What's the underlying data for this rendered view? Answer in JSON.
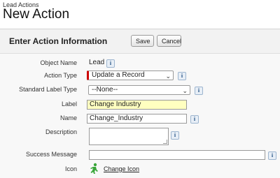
{
  "header": {
    "breadcrumb": "Lead Actions",
    "title": "New Action"
  },
  "panel": {
    "title": "Enter Action Information",
    "save_label": "Save",
    "cancel_label": "Cancel"
  },
  "fields": {
    "object_name": {
      "label": "Object Name",
      "value": "Lead"
    },
    "action_type": {
      "label": "Action Type",
      "value": "Update a Record"
    },
    "standard_label_type": {
      "label": "Standard Label Type",
      "value": "--None--"
    },
    "label": {
      "label": "Label",
      "value": "Change Industry"
    },
    "name": {
      "label": "Name",
      "value": "Change_Industry"
    },
    "description": {
      "label": "Description",
      "value": ""
    },
    "success_message": {
      "label": "Success Message",
      "value": ""
    },
    "icon": {
      "label": "Icon",
      "link": "Change Icon"
    }
  },
  "info_glyph": "i",
  "colors": {
    "required": "#cc0000",
    "highlight": "#ffffc0",
    "icon_green": "#3aa63a"
  }
}
